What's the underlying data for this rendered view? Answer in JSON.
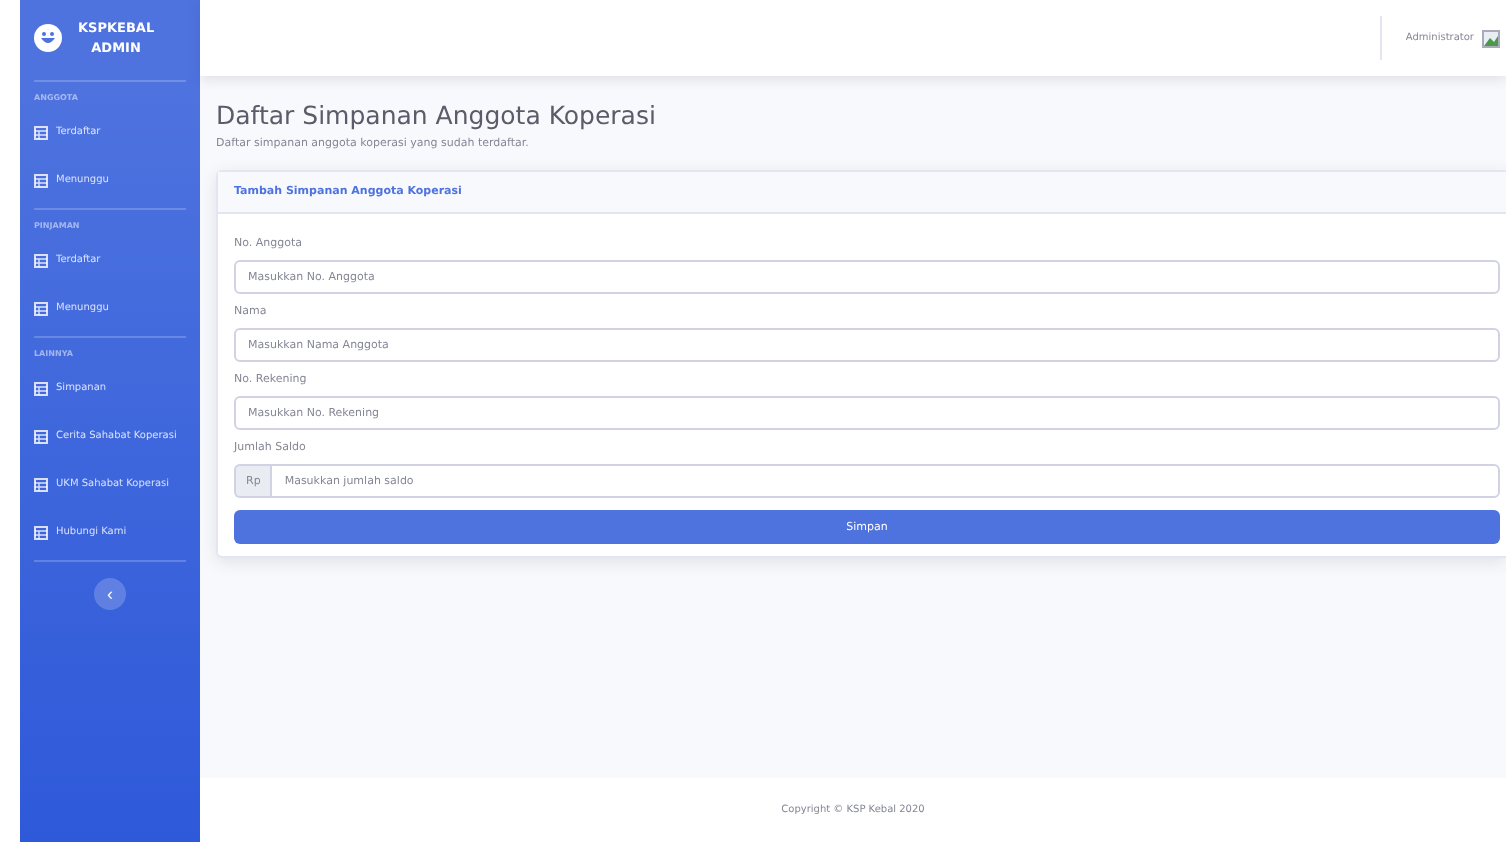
{
  "sidebar": {
    "brand": {
      "line1": "KSPKEBAL",
      "line2": "ADMIN"
    },
    "sections": [
      {
        "heading": "ANGGOTA",
        "items": [
          {
            "label": "Terdaftar",
            "selected": false
          },
          {
            "label": "Menunggu",
            "selected": false
          }
        ]
      },
      {
        "heading": "PINJAMAN",
        "items": [
          {
            "label": "Terdaftar",
            "selected": false
          },
          {
            "label": "Menunggu",
            "selected": false
          }
        ]
      },
      {
        "heading": "LAINNYA",
        "items": [
          {
            "label": "Simpanan",
            "selected": false
          },
          {
            "label": "Cerita Sahabat Koperasi",
            "selected": false
          },
          {
            "label": "UKM Sahabat Koperasi",
            "selected": false
          },
          {
            "label": "Hubungi Kami",
            "selected": false
          }
        ]
      }
    ],
    "toggle": "‹"
  },
  "topbar": {
    "user": "Administrator"
  },
  "page": {
    "title": "Daftar Simpanan Anggota Koperasi",
    "subtitle": "Daftar simpanan anggota koperasi yang sudah terdaftar."
  },
  "card": {
    "header": "Tambah Simpanan Anggota Koperasi",
    "fields": [
      {
        "kind": "text",
        "label": "No. Anggota",
        "placeholder": "Masukkan No. Anggota"
      },
      {
        "kind": "text",
        "label": "Nama",
        "placeholder": "Masukkan Nama Anggota"
      },
      {
        "kind": "text",
        "label": "No. Rekening",
        "placeholder": "Masukkan No. Rekening"
      },
      {
        "kind": "currency",
        "label": "Jumlah Saldo",
        "prefix": "Rp",
        "placeholder": "Masukkan jumlah saldo"
      }
    ],
    "submit": "Simpan"
  },
  "footer": "Copyright © KSP Kebal 2020"
}
